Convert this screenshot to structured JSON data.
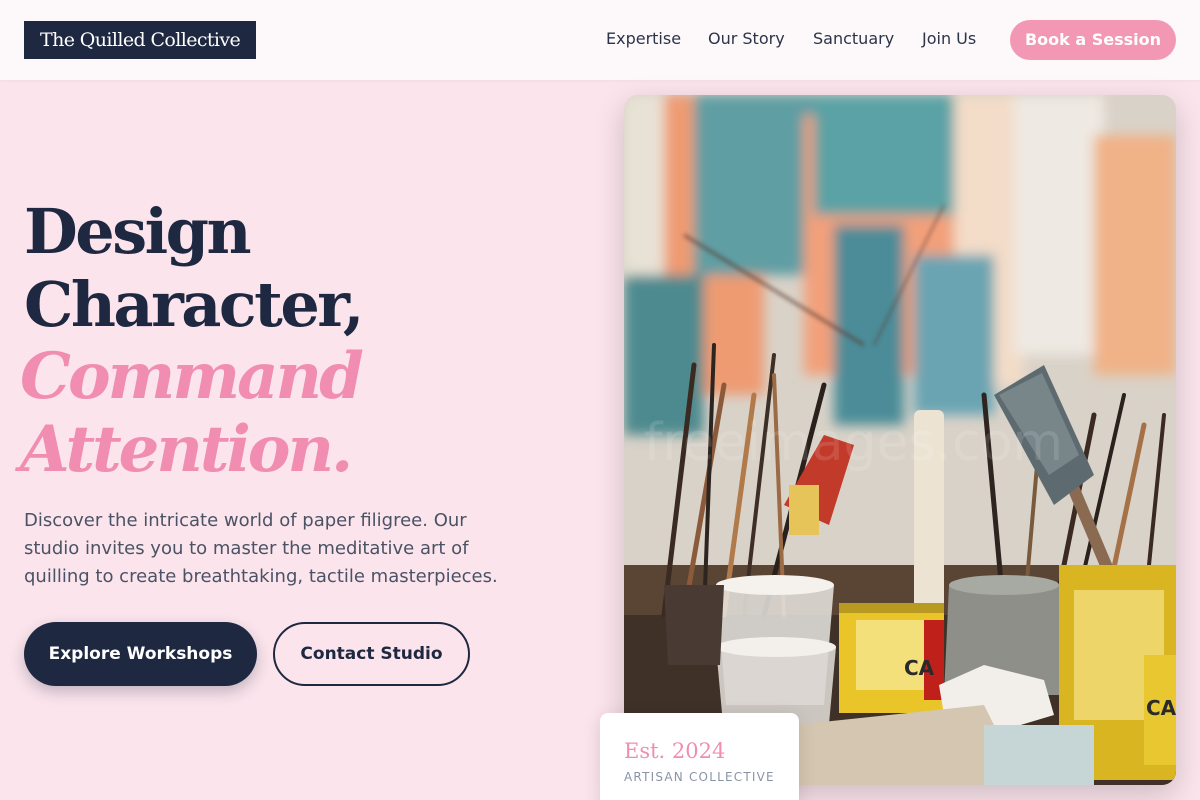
{
  "brand": {
    "logo_text": "The Quilled Collective"
  },
  "nav": {
    "links": [
      "Expertise",
      "Our Story",
      "Sanctuary",
      "Join Us"
    ],
    "cta_label": "Book a Session"
  },
  "hero": {
    "headline": [
      "Design",
      "Character,"
    ],
    "headline_accent": [
      "Command",
      "Attention."
    ],
    "description_lines": [
      "Discover the intricate world of paper filigree. Our",
      "studio invites you to master the meditative art of",
      "quilling to create breathtaking, tactile masterpieces."
    ],
    "primary_button": "Explore Workshops",
    "secondary_button": "Contact Studio"
  },
  "badge": {
    "title": "Est. 2024",
    "subtitle": "ARTISAN COLLECTIVE"
  },
  "colors": {
    "navy": "#1e2840",
    "pink": "#f08db0",
    "pink_button": "#f298b5",
    "background": "#fbe4ec"
  }
}
